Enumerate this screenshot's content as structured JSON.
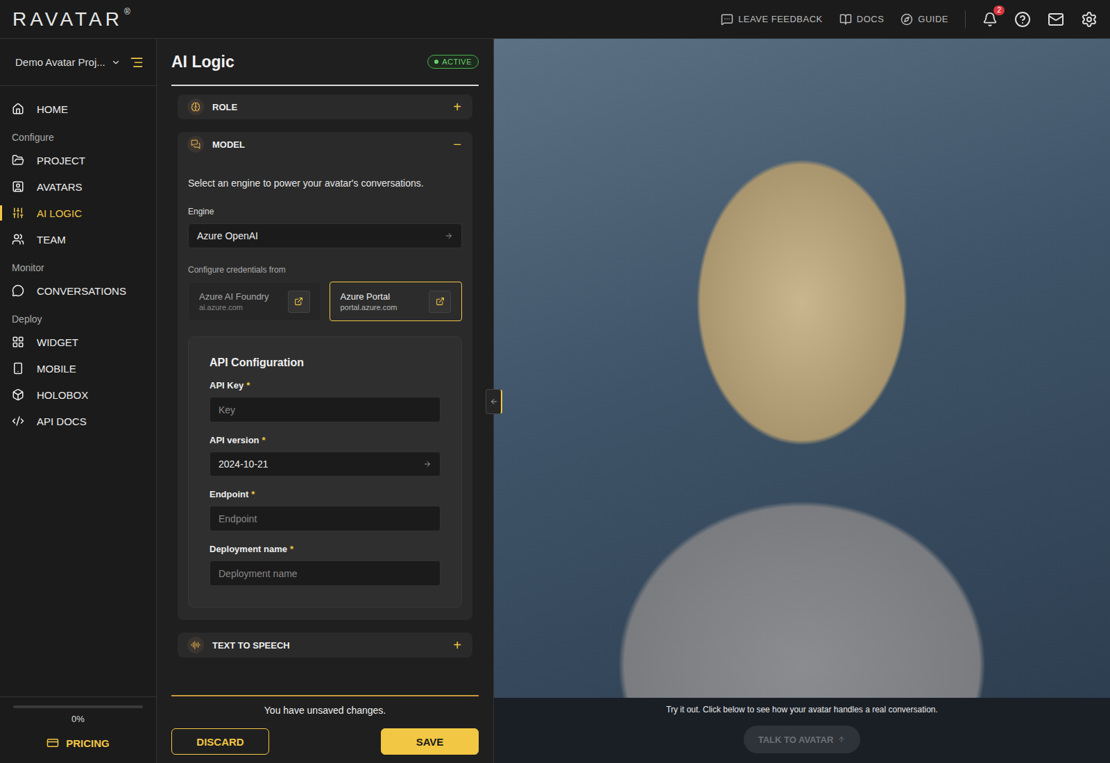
{
  "topbar": {
    "logo": "RAVATAR",
    "logo_mark": "®",
    "links": [
      {
        "label": "LEAVE FEEDBACK"
      },
      {
        "label": "DOCS"
      },
      {
        "label": "GUIDE"
      }
    ],
    "notifications": "2"
  },
  "sidebar": {
    "project": "Demo Avatar Proj...",
    "home": {
      "label": "HOME",
      "selected": false
    },
    "groups": [
      {
        "heading": "Configure",
        "items": [
          {
            "label": "PROJECT",
            "selected": false
          },
          {
            "label": "AVATARS",
            "selected": false
          },
          {
            "label": "AI LOGIC",
            "selected": true
          },
          {
            "label": "TEAM",
            "selected": false
          }
        ]
      },
      {
        "heading": "Monitor",
        "items": [
          {
            "label": "CONVERSATIONS",
            "selected": false
          }
        ]
      },
      {
        "heading": "Deploy",
        "items": [
          {
            "label": "WIDGET",
            "selected": false
          },
          {
            "label": "MOBILE",
            "selected": false
          },
          {
            "label": "HOLOBOX",
            "selected": false
          },
          {
            "label": "API DOCS",
            "selected": false
          }
        ]
      }
    ],
    "progress": {
      "reading": "0%",
      "level": 0
    },
    "pricing": "PRICING"
  },
  "panel": {
    "title": "AI Logic",
    "status": "ACTIVE",
    "sections": [
      {
        "title": "ROLE",
        "expanded": false,
        "toggle": "+"
      },
      {
        "title": "MODEL",
        "expanded": true,
        "toggle": "−"
      },
      {
        "title": "TEXT TO SPEECH",
        "expanded": false,
        "toggle": "+"
      }
    ],
    "model": {
      "description": "Select an engine to power your avatar's conversations.",
      "engine_label": "Engine",
      "engine": "Azure OpenAI",
      "credentials_label": "Configure credentials from",
      "sources": [
        {
          "name": "Azure AI Foundry",
          "url": "ai.azure.com",
          "selected": false
        },
        {
          "name": "Azure Portal",
          "url": "portal.azure.com",
          "selected": true
        }
      ],
      "api_config": {
        "title": "API Configuration",
        "required_mark": "*",
        "fields": [
          {
            "label": "API Key",
            "required": true,
            "kind": "input",
            "placeholder": "Key",
            "value": ""
          },
          {
            "label": "API version",
            "required": true,
            "kind": "select",
            "placeholder": "",
            "value": "2024-10-21"
          },
          {
            "label": "Endpoint",
            "required": true,
            "kind": "input",
            "placeholder": "Endpoint",
            "value": ""
          },
          {
            "label": "Deployment name",
            "required": true,
            "kind": "input",
            "placeholder": "Deployment name",
            "value": ""
          }
        ]
      }
    },
    "footer": {
      "message": "You have unsaved changes.",
      "discard": "DISCARD",
      "save": "SAVE"
    }
  },
  "preview": {
    "hint": "Try it out. Click below to see how your avatar handles a real conversation.",
    "button": {
      "label": "TALK TO AVATAR",
      "disabled": true
    }
  }
}
